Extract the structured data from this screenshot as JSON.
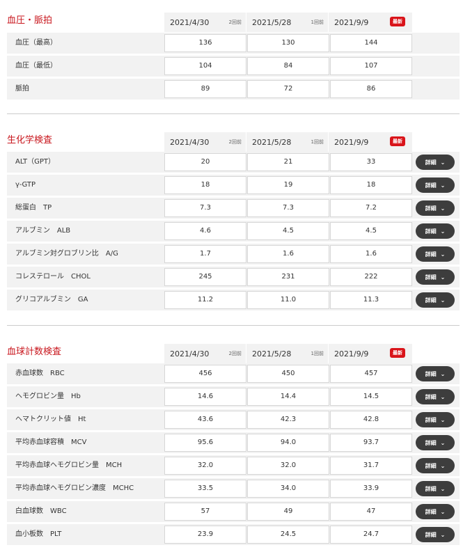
{
  "header_sub": [
    "2回前",
    "1回前"
  ],
  "badge_latest": "最新",
  "dates": [
    "2021/4/30",
    "2021/5/28",
    "2021/9/9"
  ],
  "detail_label": "詳細",
  "sections": [
    {
      "title": "血圧・脈拍",
      "rows": [
        {
          "label": "血圧（最高）",
          "values": [
            "136",
            "130",
            "144"
          ]
        },
        {
          "label": "血圧（最低）",
          "values": [
            "104",
            "84",
            "107"
          ]
        },
        {
          "label": "脈拍",
          "values": [
            "89",
            "72",
            "86"
          ]
        }
      ]
    },
    {
      "title": "生化学検査",
      "rows": [
        {
          "label": "ALT（GPT）",
          "values": [
            "20",
            "21",
            "33"
          ]
        },
        {
          "label": "γ-GTP",
          "values": [
            "18",
            "19",
            "18"
          ]
        },
        {
          "label": "総蛋白　TP",
          "values": [
            "7.3",
            "7.3",
            "7.2"
          ]
        },
        {
          "label": "アルブミン　ALB",
          "values": [
            "4.6",
            "4.5",
            "4.5"
          ]
        },
        {
          "label": "アルブミン対グロブリン比　A/G",
          "values": [
            "1.7",
            "1.6",
            "1.6"
          ]
        },
        {
          "label": "コレステロール　CHOL",
          "values": [
            "245",
            "231",
            "222"
          ]
        },
        {
          "label": "グリコアルブミン　GA",
          "values": [
            "11.2",
            "11.0",
            "11.3"
          ]
        }
      ]
    },
    {
      "title": "血球計数検査",
      "rows": [
        {
          "label": "赤血球数　RBC",
          "values": [
            "456",
            "450",
            "457"
          ]
        },
        {
          "label": "ヘモグロビン量　Hb",
          "values": [
            "14.6",
            "14.4",
            "14.5"
          ]
        },
        {
          "label": "ヘマトクリット値　Ht",
          "values": [
            "43.6",
            "42.3",
            "42.8"
          ]
        },
        {
          "label": "平均赤血球容積　MCV",
          "values": [
            "95.6",
            "94.0",
            "93.7"
          ]
        },
        {
          "label": "平均赤血球ヘモグロビン量　MCH",
          "values": [
            "32.0",
            "32.0",
            "31.7"
          ]
        },
        {
          "label": "平均赤血球ヘモグロビン濃度　MCHC",
          "values": [
            "33.5",
            "34.0",
            "33.9"
          ]
        },
        {
          "label": "白血球数　WBC",
          "values": [
            "57",
            "49",
            "47"
          ]
        },
        {
          "label": "血小板数　PLT",
          "values": [
            "23.9",
            "24.5",
            "24.7"
          ]
        }
      ]
    }
  ]
}
